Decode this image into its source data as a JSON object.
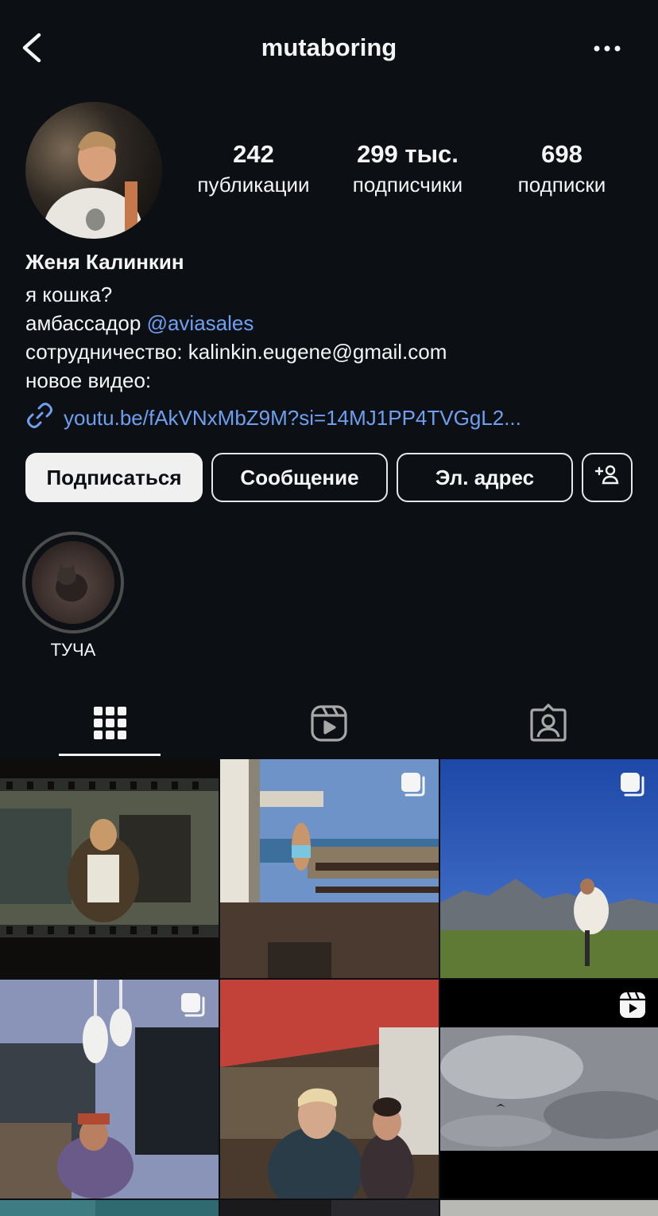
{
  "header": {
    "username": "mutaboring",
    "back_icon": "chevron-left-icon",
    "more_icon": "more-horizontal-icon"
  },
  "stats": [
    {
      "value": "242",
      "label": "публикации"
    },
    {
      "value": "299 тыс.",
      "label": "подписчики"
    },
    {
      "value": "698",
      "label": "подписки"
    }
  ],
  "profile": {
    "full_name": "Женя Калинкин",
    "bio_line1": "я кошка?",
    "bio_line2_text": "амбассадор ",
    "bio_line2_mention": "@aviasales",
    "bio_line3": "сотрудничество: kalinkin.eugene@gmail.com",
    "bio_line4": "новое видео:",
    "link": "youtu.be/fAkVNxMbZ9M?si=14MJ1PP4TVGgL2..."
  },
  "actions": {
    "follow": "Подписаться",
    "message": "Сообщение",
    "email": "Эл. адрес",
    "suggest_icon": "add-person-icon"
  },
  "highlights": [
    {
      "label": "ТУЧА"
    }
  ],
  "tabs": [
    {
      "name": "grid",
      "icon": "grid-icon",
      "active": true
    },
    {
      "name": "reels",
      "icon": "reels-icon",
      "active": false
    },
    {
      "name": "tagged",
      "icon": "tagged-person-icon",
      "active": false
    }
  ],
  "colors": {
    "background": "#0c1014",
    "link": "#6e9ff0",
    "primary_button": "#f0f0f0"
  }
}
